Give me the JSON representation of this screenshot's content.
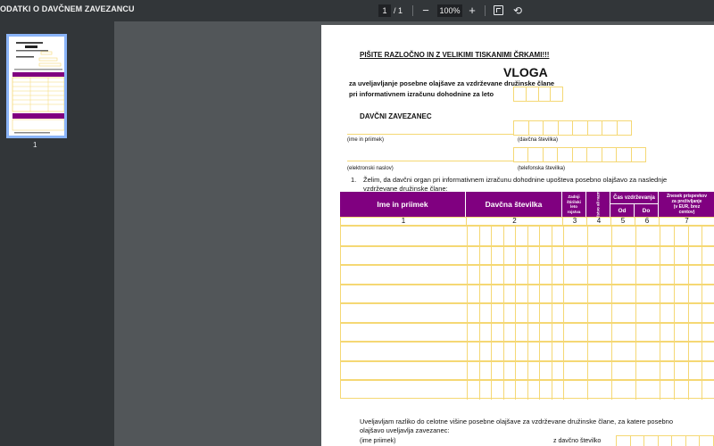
{
  "toolbar": {
    "title": "ODATKI O DAVČNEM ZAVEZANCU",
    "page_current": "1",
    "page_separator": "/",
    "page_total": "1",
    "zoom_out": "−",
    "zoom_level": "100%",
    "zoom_in": "+",
    "rotate_icon": "⟲"
  },
  "sidebar": {
    "thumbnail_page_number": "1"
  },
  "document": {
    "instruction": "PIŠITE RAZLOČNO IN Z VELIKIMI TISKANIMI ČRKAMI!!!",
    "heading": "VLOGA",
    "subtitle_1": "za uveljavljanje posebne olajšave za vzdrževane družinske člane",
    "subtitle_2": "pri informativnem izračunu dohodnine za leto",
    "section_title": "DAVČNI ZAVEZANEC",
    "label_name": "(ime in priimek)",
    "label_tax_number": "(davčna številka)",
    "label_email": "(elektronski naslov)",
    "label_phone": "(telefonska številka)",
    "item1_num": "1.",
    "item1_line1": "Želim, da davčni organ pri informativnem izračunu dohodnine upošteva posebno olajšavo za naslednje",
    "item1_line2": "vzdrževane družinske člane:",
    "table": {
      "col_name": "Ime in priimek",
      "col_tax": "Davčna številka",
      "col_year_l1": "Zadnji",
      "col_year_l2": "štirilski",
      "col_year_l3": "leto",
      "col_year_l4": "rojstva",
      "col_rel": "Sorodstvo ali razmerje*",
      "col_period": "Čas vzdrževanja",
      "col_from": "Od",
      "col_to": "Do",
      "col_amount_l1": "Znesek prispevkov",
      "col_amount_l2": "za preživljanje",
      "col_amount_l3": "(v EUR, brez",
      "col_amount_l4": "centov)",
      "numbers": [
        "1",
        "2",
        "3",
        "4",
        "5",
        "6",
        "7"
      ]
    },
    "bottom_line1": "Uveljavljam razliko do celotne višine posebne olajšave za vzdrževane družinske člane, za katere posebno",
    "bottom_line2": "olajšavo uveljavlja zavezanec:",
    "bottom_label_name": "(ime priimek)",
    "bottom_label_tax": "z davčno številko"
  },
  "colors": {
    "accent_purple": "#800080",
    "field_yellow": "#f5d874",
    "toolbar_bg": "#323639"
  }
}
